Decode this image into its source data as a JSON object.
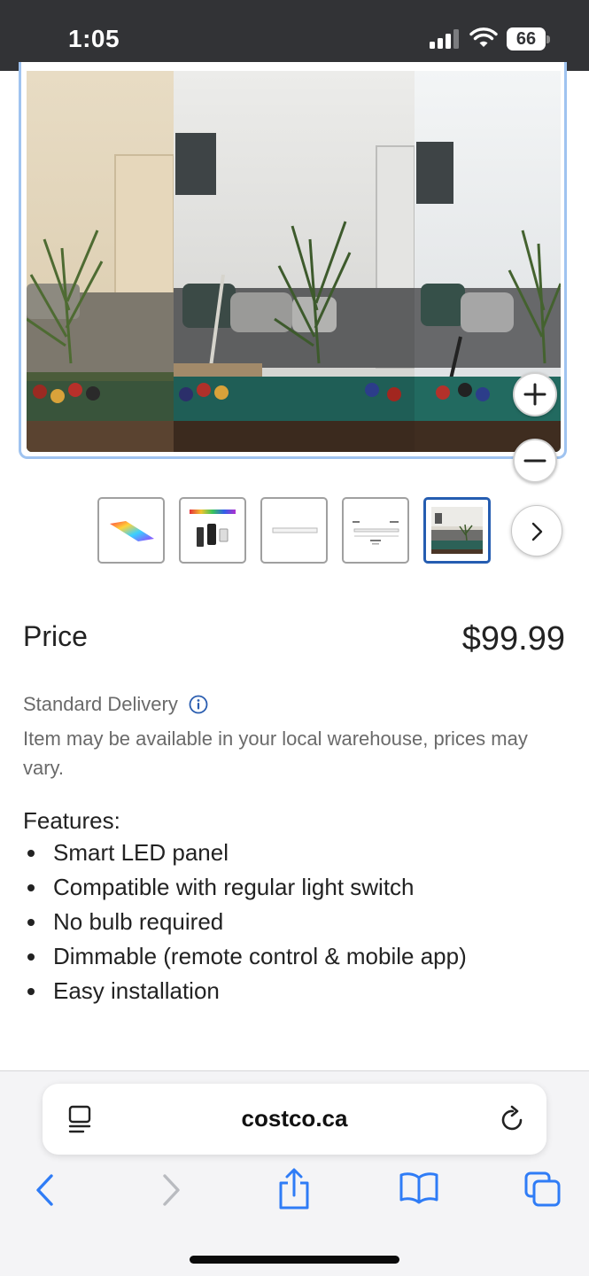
{
  "status_bar": {
    "time": "1:05",
    "battery": "66"
  },
  "product_image": {
    "alt": "Smart LED panel lighting comparison in a room with pool table"
  },
  "zoom": {
    "zoom_in_icon": "plus-icon",
    "zoom_out_icon": "minus-icon"
  },
  "thumbnails": [
    {
      "name": "rgb-panel-thumbnail"
    },
    {
      "name": "color-spectrum-remote-thumbnail"
    },
    {
      "name": "flat-panel-thumbnail"
    },
    {
      "name": "dimensions-diagram-thumbnail"
    },
    {
      "name": "room-scene-thumbnail",
      "selected": true
    }
  ],
  "price": {
    "label": "Price",
    "value": "$99.99"
  },
  "delivery": {
    "label": "Standard Delivery",
    "note": "Item may be available in your local warehouse, prices may vary."
  },
  "features": {
    "title": "Features:",
    "items": [
      "Smart LED panel",
      "Compatible with regular light switch",
      "No bulb required",
      "Dimmable (remote control & mobile app)",
      "Easy installation"
    ]
  },
  "browser": {
    "url": "costco.ca"
  },
  "colors": {
    "status_bar_bg": "#323336",
    "selected_border": "#255db1",
    "ios_blue": "#2f7cf6"
  }
}
